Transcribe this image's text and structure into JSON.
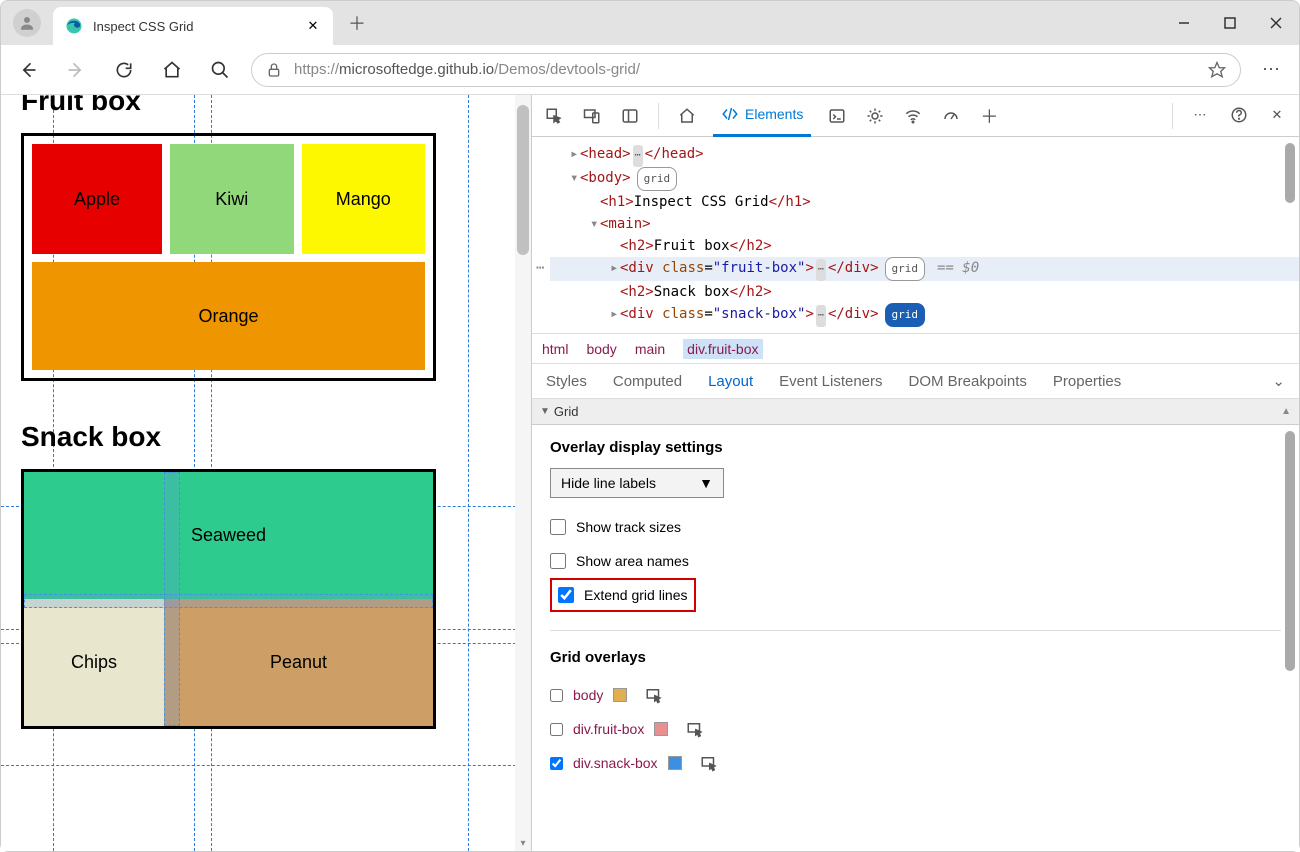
{
  "window": {
    "tab_title": "Inspect CSS Grid"
  },
  "toolbar": {
    "url_proto": "https://",
    "url_host": "microsoftedge.github.io",
    "url_path": "/Demos/devtools-grid/"
  },
  "page": {
    "h2_fruit": "Fruit box",
    "h2_snack": "Snack box",
    "fruits": {
      "apple": "Apple",
      "kiwi": "Kiwi",
      "mango": "Mango",
      "orange": "Orange"
    },
    "snacks": {
      "seaweed": "Seaweed",
      "chips": "Chips",
      "peanut": "Peanut"
    }
  },
  "dom": {
    "head": "<head>",
    "head_close": "</head>",
    "body": "<body>",
    "grid_badge": "grid",
    "h1_open": "<h1>",
    "h1_text": "Inspect CSS Grid",
    "h1_close": "</h1>",
    "main_open": "<main>",
    "h2f_open": "<h2>",
    "h2f_text": "Fruit box",
    "h2f_close": "</h2>",
    "divf_open": "<div ",
    "divf_class": "class",
    "divf_val": "\"fruit-box\"",
    "divf_gt": ">",
    "divf_close": "</div>",
    "eqd": "== $0",
    "h2s_open": "<h2>",
    "h2s_text": "Snack box",
    "h2s_close": "</h2>",
    "divs_open": "<div ",
    "divs_class": "class",
    "divs_val": "\"snack-box\"",
    "divs_gt": ">",
    "divs_close": "</div>"
  },
  "breadcrumbs": [
    "html",
    "body",
    "main",
    "div.fruit-box"
  ],
  "subtabs": [
    "Styles",
    "Computed",
    "Layout",
    "Event Listeners",
    "DOM Breakpoints",
    "Properties"
  ],
  "section_hdr": "Grid",
  "layout": {
    "overlay_heading": "Overlay display settings",
    "select_val": "Hide line labels",
    "chk1": "Show track sizes",
    "chk2": "Show area names",
    "chk3": "Extend grid lines",
    "overlays_heading": "Grid overlays",
    "ov1": "body",
    "ov2": "div.fruit-box",
    "ov3": "div.snack-box"
  },
  "devtabs": {
    "elements": "Elements"
  }
}
